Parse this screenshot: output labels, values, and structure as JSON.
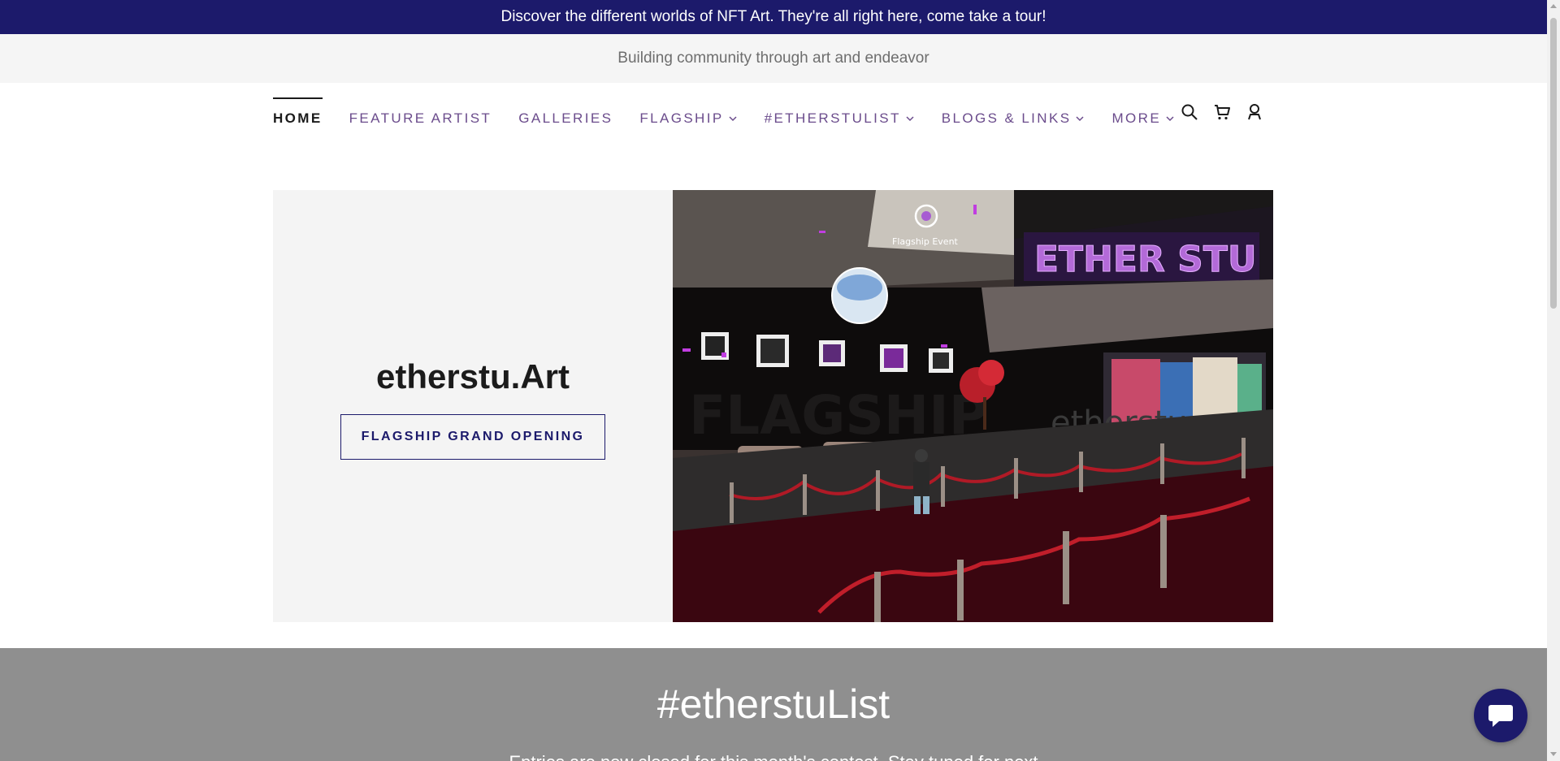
{
  "announcement": "Discover the different worlds of NFT Art. They're all right here, come take a tour!",
  "tagline": "Building community through art and endeavor",
  "nav": {
    "items": [
      {
        "label": "HOME",
        "active": true,
        "dropdown": false
      },
      {
        "label": "FEATURE ARTIST",
        "active": false,
        "dropdown": false
      },
      {
        "label": "GALLERIES",
        "active": false,
        "dropdown": false
      },
      {
        "label": "FLAGSHIP",
        "active": false,
        "dropdown": true
      },
      {
        "label": "#ETHERSTULIST",
        "active": false,
        "dropdown": true
      },
      {
        "label": "BLOGS & LINKS",
        "active": false,
        "dropdown": true
      },
      {
        "label": "MORE",
        "active": false,
        "dropdown": true
      }
    ],
    "icons": [
      "search-icon",
      "cart-icon",
      "account-icon"
    ]
  },
  "hero": {
    "title": "etherstu.Art",
    "button_label": "FLAGSHIP GRAND OPENING",
    "image": {
      "event_label": "Flagship Event",
      "wall_text": "FLAGSHIP",
      "sign_text": "ETHER STU",
      "brand_text": "etherstu"
    }
  },
  "list_section": {
    "title": "#etherstuList",
    "subtitle": "Entries are now closed for this month's contest. Stay tuned for next"
  },
  "colors": {
    "brand": "#1c1a6b",
    "nav_text": "#6b4c8c",
    "tagline_bg": "#f5f5f5"
  }
}
